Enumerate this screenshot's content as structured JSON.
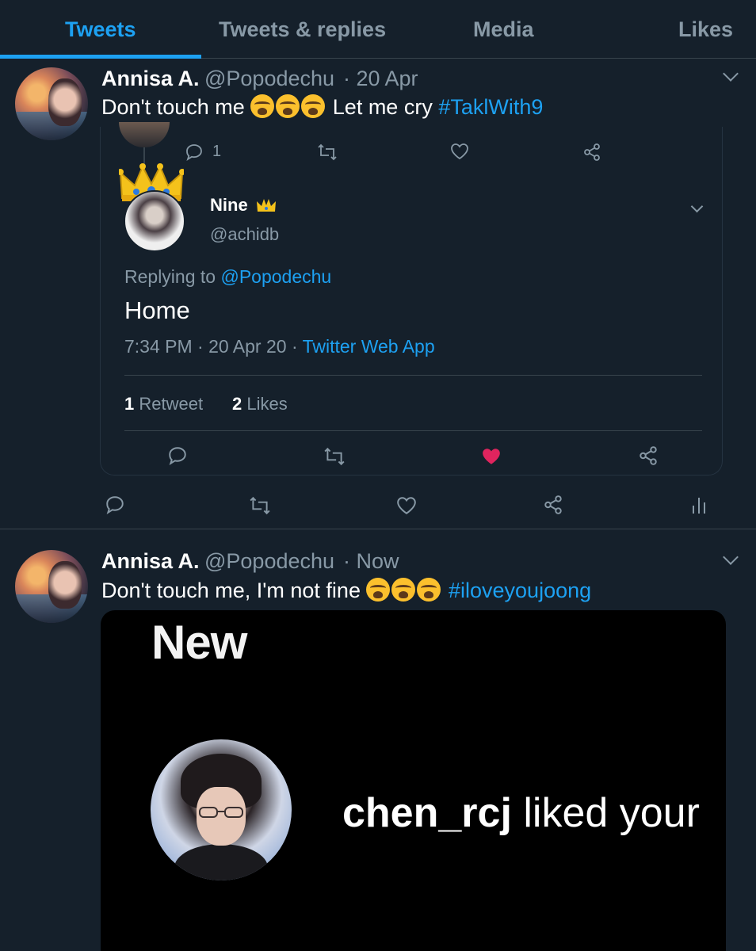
{
  "tabs": [
    {
      "label": "Tweets",
      "active": true
    },
    {
      "label": "Tweets & replies",
      "active": false
    },
    {
      "label": "Media",
      "active": false
    },
    {
      "label": "Likes",
      "active": false
    }
  ],
  "tweet1": {
    "name": "Annisa A.",
    "handle": "@Popodechu",
    "time": "· 20 Apr",
    "text": "Don't touch me",
    "text2": "Let me cry",
    "hashtag": "#TaklWith9",
    "emoji_count": 3,
    "thread_reply_count": "1",
    "embed": {
      "name": "Nine",
      "handle": "@achidb",
      "replying_prefix": "Replying to",
      "replying_to": "@Popodechu",
      "text": "Home",
      "timestamp": "7:34 PM · 20 Apr 20 · ",
      "source": "Twitter Web App",
      "retweets_count": "1",
      "retweets_label": "Retweet",
      "likes_count": "2",
      "likes_label": "Likes",
      "liked": true
    }
  },
  "tweet2": {
    "name": "Annisa A.",
    "handle": "@Popodechu",
    "time": "· Now",
    "text": "Don't touch me, I'm not fine",
    "hashtag": "#iloveyoujoong",
    "emoji_count": 3,
    "media": {
      "heading": "New",
      "username": "chen_rcj",
      "caption": "liked your"
    }
  },
  "colors": {
    "background": "#15202b",
    "accent": "#1da1f2",
    "muted": "#8899a6",
    "like": "#e0245e",
    "border": "#38444d"
  },
  "icons": [
    "reply-icon",
    "retweet-icon",
    "like-icon",
    "share-icon",
    "analytics-icon",
    "chevron-down-icon",
    "crown-icon"
  ]
}
